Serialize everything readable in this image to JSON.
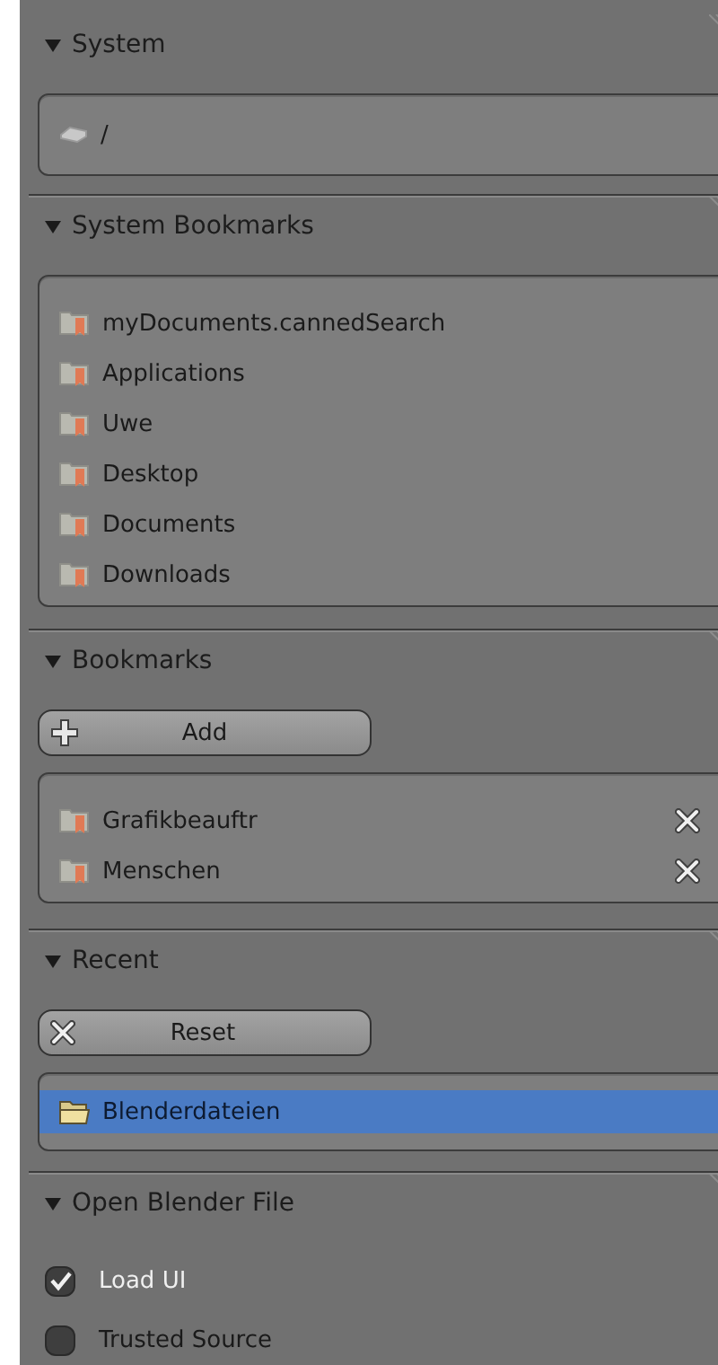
{
  "sections": [
    {
      "title": "System",
      "expanded": true,
      "kind": "volumes",
      "items": [
        {
          "label": "/",
          "selected": false
        }
      ]
    },
    {
      "title": "System Bookmarks",
      "expanded": true,
      "kind": "bookmarks",
      "items": [
        {
          "label": "myDocuments.cannedSearch",
          "selected": false
        },
        {
          "label": "Applications",
          "selected": false
        },
        {
          "label": "Uwe",
          "selected": false
        },
        {
          "label": "Desktop",
          "selected": false
        },
        {
          "label": "Documents",
          "selected": false
        },
        {
          "label": "Downloads",
          "selected": false
        }
      ]
    },
    {
      "title": "Bookmarks",
      "expanded": true,
      "kind": "bookmarks",
      "removable": true,
      "button": {
        "label": "Add",
        "kind": "add"
      },
      "items": [
        {
          "label": "Grafikbeauftr",
          "selected": false
        },
        {
          "label": "Menschen",
          "selected": false
        }
      ]
    },
    {
      "title": "Recent",
      "expanded": true,
      "kind": "recent",
      "button": {
        "label": "Reset",
        "kind": "reset"
      },
      "items": [
        {
          "label": "Blenderdateien",
          "selected": true
        }
      ]
    },
    {
      "title": "Open Blender File",
      "expanded": true,
      "kind": "options",
      "options": [
        {
          "label": "Load UI",
          "checked": true
        },
        {
          "label": "Trusted Source",
          "checked": false
        }
      ]
    }
  ]
}
